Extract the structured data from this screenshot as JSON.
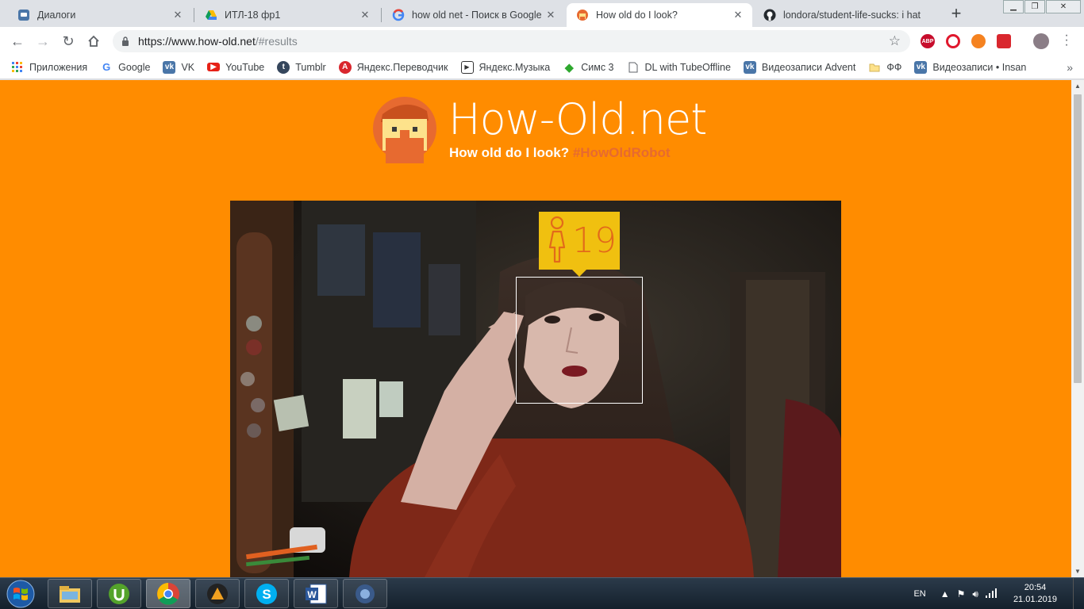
{
  "browser": {
    "tabs": [
      {
        "title": "Диалоги",
        "icon": "vk-messages-icon"
      },
      {
        "title": "ИТЛ-18 фр1",
        "icon": "google-drive-icon"
      },
      {
        "title": "how old net - Поиск в Google",
        "icon": "google-icon"
      },
      {
        "title": "How old do I look?",
        "icon": "howold-icon",
        "active": true
      },
      {
        "title": "londora/student-life-sucks: i hat",
        "icon": "github-icon"
      }
    ],
    "url_host": "https://www.how-old.net",
    "url_path": "/#results",
    "bookmarks": [
      {
        "label": "Приложения",
        "icon": "apps-grid-icon"
      },
      {
        "label": "Google",
        "icon": "google-icon"
      },
      {
        "label": "VK",
        "icon": "vk-icon"
      },
      {
        "label": "YouTube",
        "icon": "youtube-icon"
      },
      {
        "label": "Tumblr",
        "icon": "tumblr-icon"
      },
      {
        "label": "Яндекс.Переводчик",
        "icon": "yandex-translate-icon"
      },
      {
        "label": "Яндекс.Музыка",
        "icon": "yandex-music-icon"
      },
      {
        "label": "Симс 3",
        "icon": "sims-icon"
      },
      {
        "label": "DL with TubeOffline",
        "icon": "page-icon"
      },
      {
        "label": "Видеозаписи Advent",
        "icon": "vk-icon"
      },
      {
        "label": "ФФ",
        "icon": "folder-icon"
      },
      {
        "label": "Видеозаписи • Insan",
        "icon": "vk-icon"
      }
    ],
    "extensions": [
      {
        "name": "adblock-plus-icon",
        "text": "ABP",
        "color": "#c70d2c"
      },
      {
        "name": "opera-icon",
        "text": "",
        "color": "#e0182d"
      },
      {
        "name": "orange-ext-icon",
        "text": "",
        "color": "#f58220"
      },
      {
        "name": "mega-icon",
        "text": "",
        "color": "#d9272e"
      }
    ]
  },
  "page": {
    "site_title": "How-Old.net",
    "tagline": "How old do I look?",
    "hashtag": "#HowOldRobot",
    "result": {
      "gender": "female",
      "age": "19"
    }
  },
  "colors": {
    "page_bg": "#ff8c00",
    "badge": "#f0c010",
    "age_text": "#e26a1a",
    "hashtag": "#e76a30"
  },
  "taskbar": {
    "apps": [
      "windows-explorer-icon",
      "utorrent-icon",
      "chrome-icon",
      "aimp-icon",
      "skype-icon",
      "word-icon",
      "media-center-icon"
    ],
    "language": "EN",
    "time": "20:54",
    "date": "21.01.2019"
  }
}
